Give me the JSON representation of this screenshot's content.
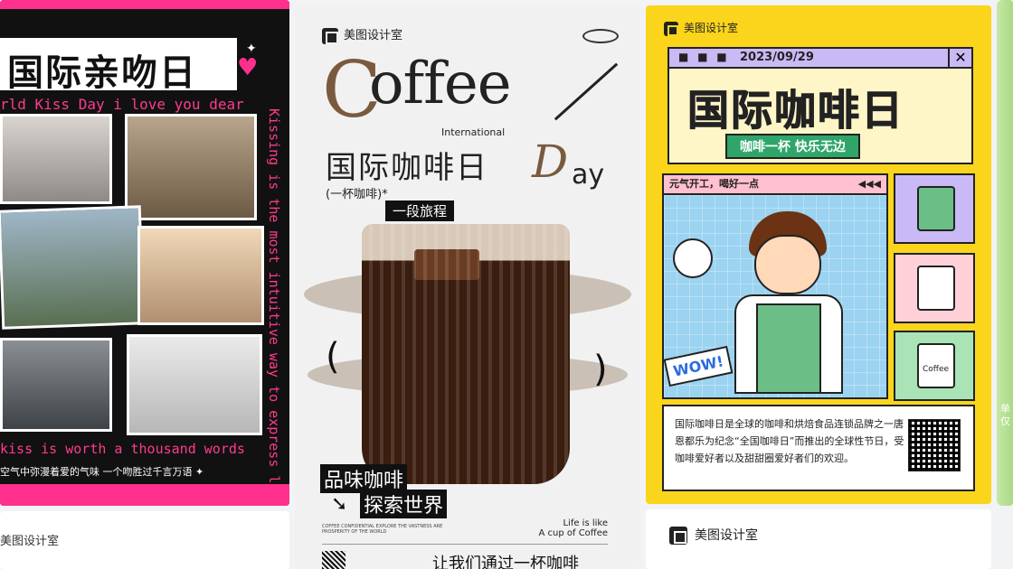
{
  "cards": {
    "kiss_day": {
      "title": "国际亲吻日",
      "subtitle": "rld Kiss Day i love you dear",
      "vertical_text": "Kissing is the most intuitive way to express love",
      "bottom_line1": "kiss is worth a thousand words",
      "bottom_line2": "空气中弥漫着爱的气味  一个吻胜过千言万语 ✦"
    },
    "coffee_day": {
      "brand": "美图设计室",
      "title_word": "offee",
      "title_c": "C",
      "international": "International",
      "chinese_title": "国际咖啡日",
      "day_word": "D",
      "day_suffix": "ay",
      "cup_text": "(一杯咖啡)*",
      "journey": "一段旅程",
      "paren_left": "(",
      "paren_right": ")",
      "taste": "品味咖啡",
      "explore": "探索世界",
      "fine_print": "COFFEE CONFIDENTIAL EXPLORE THE VASTNESS ARE PROSPERITY OF THE WORLD",
      "life_line1": "Life is like",
      "life_line2": "A cup of Coffee",
      "bottom_text": "让我们通过一杯咖啡"
    },
    "yellow_coffee": {
      "brand": "美图设计室",
      "dots": "■ ■ ■",
      "date": "2023/09/29",
      "close": "✕",
      "big_title": "国际咖啡日",
      "banner": "咖啡一杯  快乐无边",
      "panel_title": "元气开工，喝好一点",
      "panel_arrows": "◀◀◀",
      "wow": "WOW!",
      "coffee_label": "Coffee",
      "description": "国际咖啡日是全球的咖啡和烘焙食品连锁品牌之一唐恩都乐为纪念“全国咖啡日”而推出的全球性节日，受咖啡爱好者以及甜甜圈爱好者们的欢迎。"
    },
    "bottom_brand_left": "美图设计室",
    "bottom_brand_right": "美图设计室",
    "sliver_text": "单仅"
  }
}
